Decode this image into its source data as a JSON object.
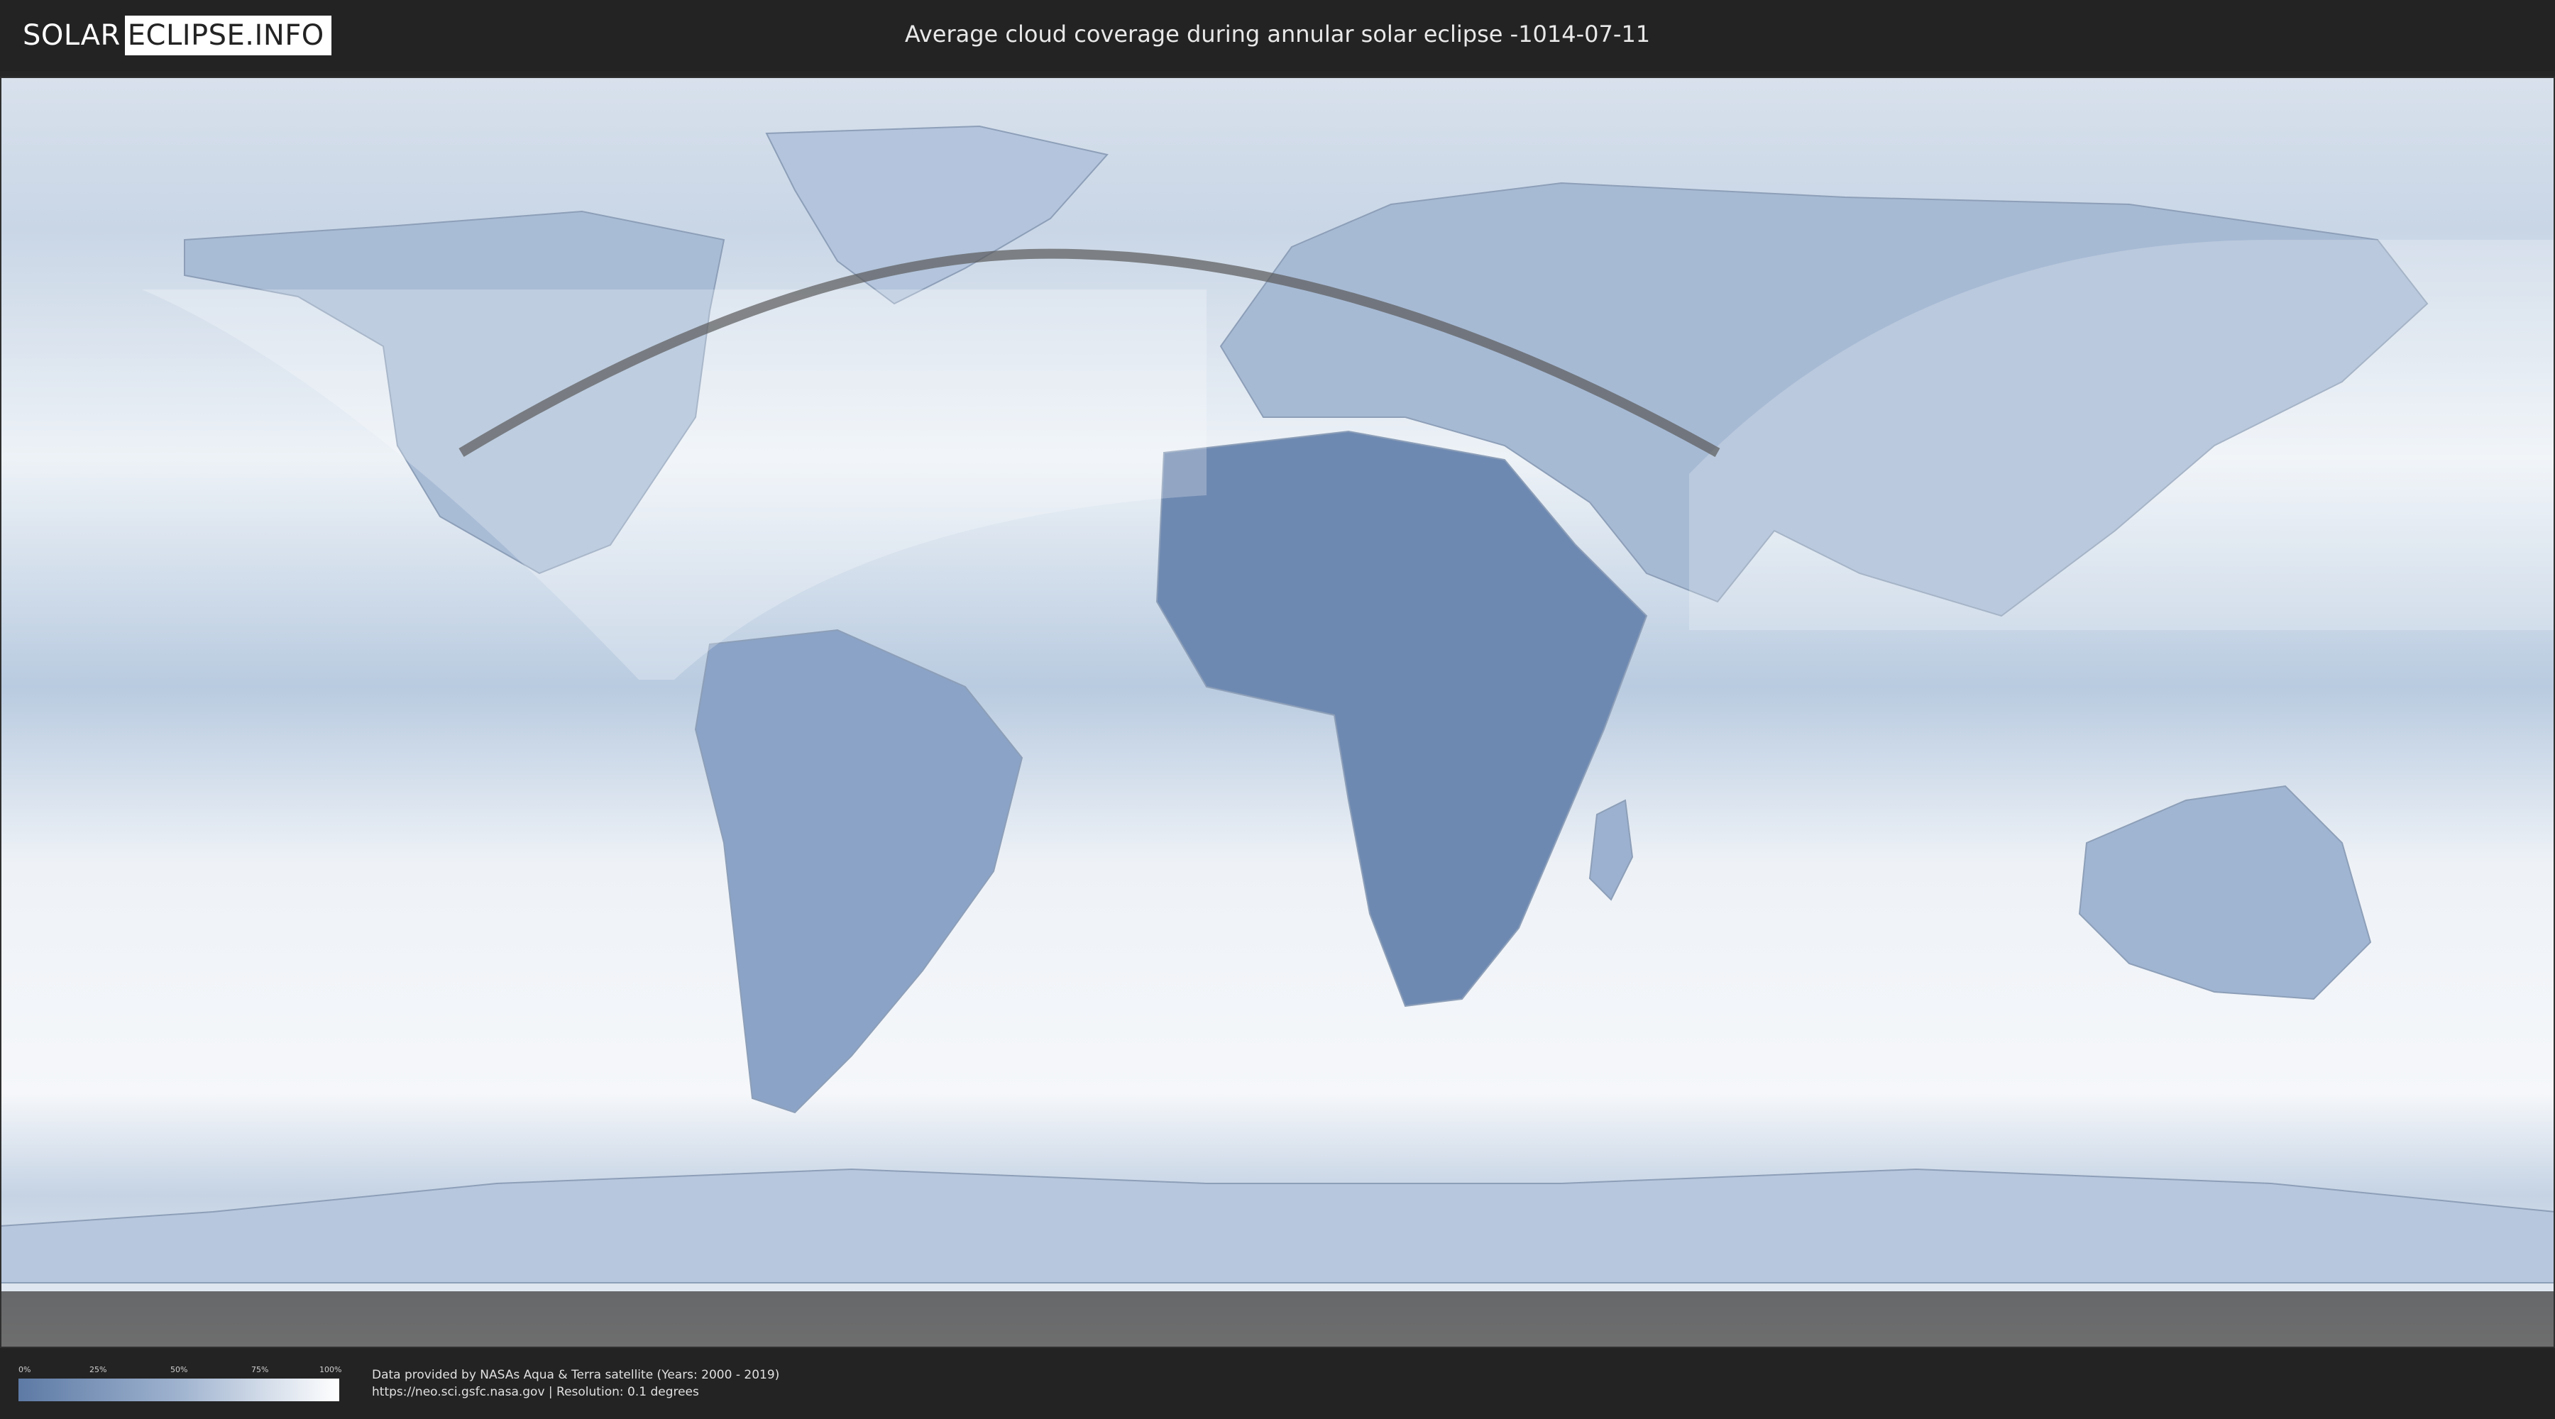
{
  "header": {
    "logo_left": "SOLAR",
    "logo_right": "ECLIPSE.INFO",
    "title": "Average cloud coverage during annular solar eclipse -1014-07-11"
  },
  "legend": {
    "ticks": [
      "0%",
      "25%",
      "50%",
      "75%",
      "100%"
    ],
    "scale": [
      0,
      25,
      50,
      75,
      100
    ],
    "colors": [
      "#5d7aa5",
      "#9fb3cf",
      "#ffffff"
    ]
  },
  "footer": {
    "credit_line1": "Data provided by NASAs Aqua & Terra satellite (Years: 2000 - 2019)",
    "credit_line2": "https://neo.sci.gsfc.nasa.gov | Resolution: 0.1 degrees"
  },
  "colors": {
    "header_bg": "#232323",
    "ocean_cloud": "#e9eef5",
    "dense_cloud": "#5f7ca8",
    "eclipse_path": "#5a5a5a"
  }
}
